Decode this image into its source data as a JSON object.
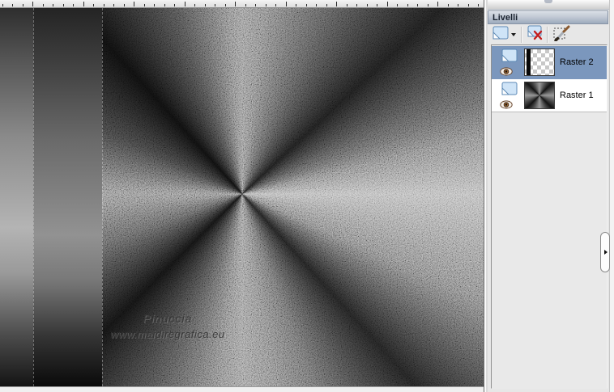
{
  "canvas": {
    "watermark": {
      "line1": "Pinuccia",
      "line2": "www.maidiregrafica.eu"
    }
  },
  "panel": {
    "title": "Livelli",
    "toolbar": {
      "buttons": [
        {
          "name": "new-layer",
          "icon": "new-layer-icon",
          "has_dropdown": true
        },
        {
          "name": "delete-layer",
          "icon": "delete-layer-icon"
        },
        {
          "name": "edit-selection",
          "icon": "edit-selection-brush-icon"
        }
      ]
    },
    "layers": [
      {
        "label": "Raster 2",
        "selected": true,
        "visible": true,
        "thumbnail": "transparency-checker-with-black-bar"
      },
      {
        "label": "Raster 1",
        "selected": false,
        "visible": true,
        "thumbnail": "gray-conic-sunburst"
      }
    ],
    "colors": {
      "selected_row": "#7b97bd",
      "header_top": "#d9dee6",
      "header_bottom": "#9daabc",
      "panel_bg": "#e7e7e7"
    }
  }
}
